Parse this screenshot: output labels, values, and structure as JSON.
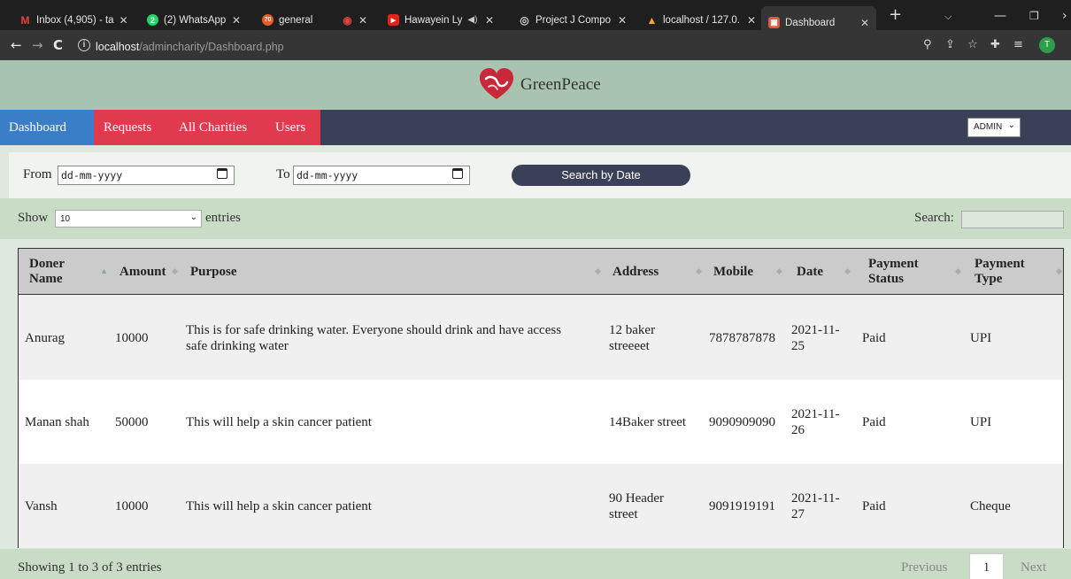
{
  "browser": {
    "tabs": [
      {
        "title": "Inbox (4,905) - ta",
        "icon": "gmail-icon",
        "color": "#c5221f",
        "glyph": "M"
      },
      {
        "title": "(2) WhatsApp",
        "icon": "whatsapp-icon",
        "color": "#25d366",
        "glyph": "2"
      },
      {
        "title": "general",
        "icon": "channel-icon",
        "color": "#e85d26",
        "glyph": "70"
      },
      {
        "title": "",
        "icon": "record-icon",
        "color": "#d9453d",
        "glyph": "◉"
      },
      {
        "title": "Hawayein Ly",
        "icon": "youtube-icon",
        "color": "#e62117",
        "glyph": "▶"
      },
      {
        "title": "Project J Compo",
        "icon": "globe-icon",
        "color": "#5f6368",
        "glyph": "◎"
      },
      {
        "title": "localhost / 127.0.",
        "icon": "phpmyadmin-icon",
        "color": "#f0a830",
        "glyph": "▲"
      },
      {
        "title": "Dashboard",
        "icon": "site-icon",
        "color": "#e05a3a",
        "glyph": "▣"
      }
    ],
    "new_tab": "+",
    "url_host": "localhost",
    "url_path": "/admincharity/Dashboard.php",
    "profile_initial": "T"
  },
  "site": {
    "brand": "GreenPeace",
    "nav": [
      "Dashboard",
      "Requests",
      "All Charities",
      "Users"
    ],
    "admin_select": "ADMIN"
  },
  "filter": {
    "from_label": "From",
    "from_placeholder": "dd-mm-yyyy",
    "to_label": "To",
    "to_placeholder": "dd-mm-yyyy",
    "search_button": "Search by Date"
  },
  "table_controls": {
    "show_label": "Show",
    "entries_value": "10",
    "entries_label": "entries",
    "search_label": "Search:"
  },
  "table": {
    "headers": [
      {
        "line1": "Doner",
        "line2": "Name"
      },
      {
        "line1": "Amount",
        "line2": ""
      },
      {
        "line1": "Purpose",
        "line2": ""
      },
      {
        "line1": "Address",
        "line2": ""
      },
      {
        "line1": "Mobile",
        "line2": ""
      },
      {
        "line1": "Date",
        "line2": ""
      },
      {
        "line1": "Payment",
        "line2": "Status"
      },
      {
        "line1": "Payment",
        "line2": "Type"
      }
    ],
    "rows": [
      {
        "name": "Anurag",
        "amount": "10000",
        "purpose_1": "This is for safe drinking water. Everyone should drink and have access",
        "purpose_2": "safe drinking water",
        "address_1": "12 baker",
        "address_2": "streeeet",
        "mobile": "7878787878",
        "date_1": "2021-11-",
        "date_2": "25",
        "status": "Paid",
        "type": "UPI"
      },
      {
        "name": "Manan shah",
        "amount": "50000",
        "purpose_1": "This will help a skin cancer patient",
        "purpose_2": "",
        "address_1": "14Baker street",
        "address_2": "",
        "mobile": "9090909090",
        "date_1": "2021-11-",
        "date_2": "26",
        "status": "Paid",
        "type": "UPI"
      },
      {
        "name": "Vansh",
        "amount": "10000",
        "purpose_1": "This will help a skin cancer patient",
        "purpose_2": "",
        "address_1": "90 Header",
        "address_2": "street",
        "mobile": "9091919191",
        "date_1": "2021-11-",
        "date_2": "27",
        "status": "Paid",
        "type": "Cheque"
      }
    ]
  },
  "footer": {
    "info": "Showing 1 to 3 of 3 entries",
    "previous": "Previous",
    "page": "1",
    "next": "Next"
  }
}
